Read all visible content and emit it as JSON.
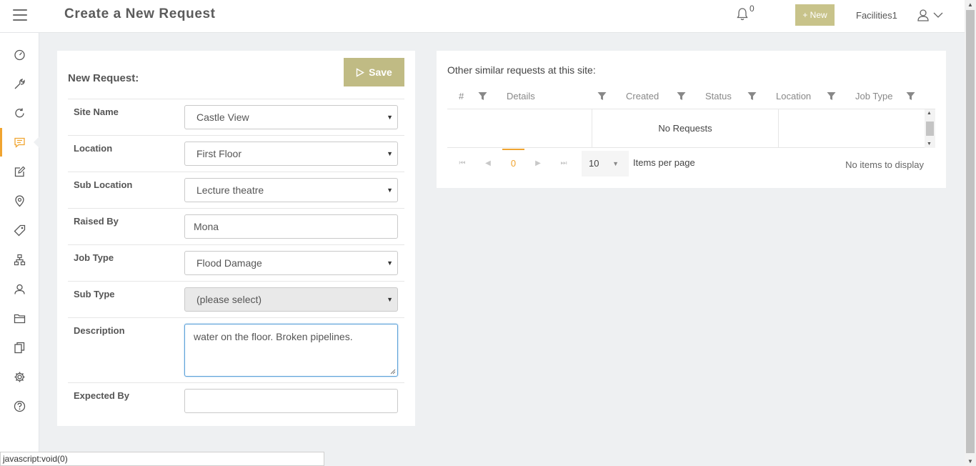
{
  "header": {
    "title": "Create a New Request",
    "notification_count": "0",
    "new_button": "+ New",
    "user_name": "Facilities1"
  },
  "sidebar": {
    "items": [
      {
        "icon": "dashboard-icon"
      },
      {
        "icon": "wrench-icon"
      },
      {
        "icon": "refresh-icon"
      },
      {
        "icon": "chat-icon",
        "active": true
      },
      {
        "icon": "edit-icon"
      },
      {
        "icon": "location-pin-icon"
      },
      {
        "icon": "tag-icon"
      },
      {
        "icon": "hierarchy-icon"
      },
      {
        "icon": "contacts-icon"
      },
      {
        "icon": "folder-icon"
      },
      {
        "icon": "documents-icon"
      },
      {
        "icon": "gear-icon"
      },
      {
        "icon": "help-icon"
      }
    ]
  },
  "form": {
    "title": "New Request:",
    "save_label": "Save",
    "fields": {
      "site_name": {
        "label": "Site Name",
        "value": "Castle View"
      },
      "location": {
        "label": "Location",
        "value": "First Floor"
      },
      "sub_location": {
        "label": "Sub Location",
        "value": "Lecture theatre"
      },
      "raised_by": {
        "label": "Raised By",
        "value": "Mona"
      },
      "job_type": {
        "label": "Job Type",
        "value": "Flood Damage"
      },
      "sub_type": {
        "label": "Sub Type",
        "value": "(please select)"
      },
      "description": {
        "label": "Description",
        "value": "water on the floor. Broken pipelines."
      },
      "expected_by": {
        "label": "Expected By",
        "value": ""
      }
    }
  },
  "similar": {
    "title": "Other similar requests at this site:",
    "columns": [
      "#",
      "Details",
      "Created",
      "Status",
      "Location",
      "Job Type"
    ],
    "empty_message": "No Requests",
    "pager": {
      "current_page": "0",
      "page_size": "10",
      "items_per_page_label": "Items per page",
      "info": "No items to display"
    }
  },
  "statusbar": {
    "text": "javascript:void(0)"
  },
  "colors": {
    "accent": "#f0a430",
    "button": "#c0bb84"
  }
}
